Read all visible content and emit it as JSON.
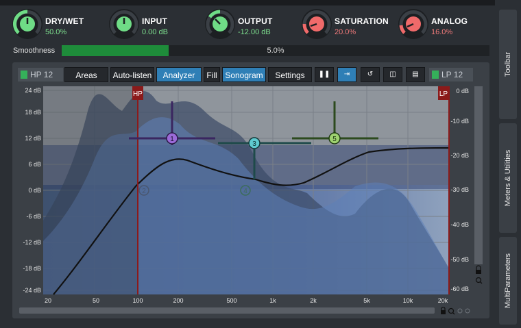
{
  "knobs": [
    {
      "name": "DRY/WET",
      "value": "50.0%",
      "color": "#6fdc86"
    },
    {
      "name": "INPUT",
      "value": "0.00 dB",
      "color": "#6fdc86"
    },
    {
      "name": "OUTPUT",
      "value": "-12.00 dB",
      "color": "#6fdc86"
    },
    {
      "name": "SATURATION",
      "value": "20.0%",
      "color": "#f06a6a"
    },
    {
      "name": "ANALOG",
      "value": "16.0%",
      "color": "#f06a6a"
    }
  ],
  "smoothness": {
    "label": "Smoothness",
    "value": "5.0%",
    "fill": 0.05
  },
  "toolbar": {
    "hp_label": "HP 12",
    "lp_label": "LP 12",
    "areas": "Areas",
    "auto_listen": "Auto-listen",
    "analyzer": "Analyzer",
    "fill": "Fill",
    "sonogram": "Sonogram",
    "settings": "Settings"
  },
  "graph": {
    "left_axis": [
      "24 dB",
      "18 dB",
      "12 dB",
      "6 dB",
      "0 dB",
      "-6 dB",
      "-12 dB",
      "-18 dB",
      "-24 dB"
    ],
    "right_axis": [
      "0 dB",
      "-10 dB",
      "-20 dB",
      "-30 dB",
      "-40 dB",
      "-50 dB",
      "-60 dB"
    ],
    "freq_axis": [
      "20",
      "50",
      "100",
      "200",
      "500",
      "1k",
      "2k",
      "5k",
      "10k",
      "20k"
    ],
    "hp_marker": "HP",
    "lp_marker": "LP",
    "bands": [
      "1",
      "2",
      "3",
      "4",
      "5"
    ]
  },
  "side_tabs": {
    "toolbar": "Toolbar",
    "meters": "Meters & Utilities",
    "multiparams": "MultiParameters"
  },
  "colors": {
    "accent": "#2f7fb6",
    "green": "#1e8c3a",
    "filter_red": "#8b1a1a"
  }
}
